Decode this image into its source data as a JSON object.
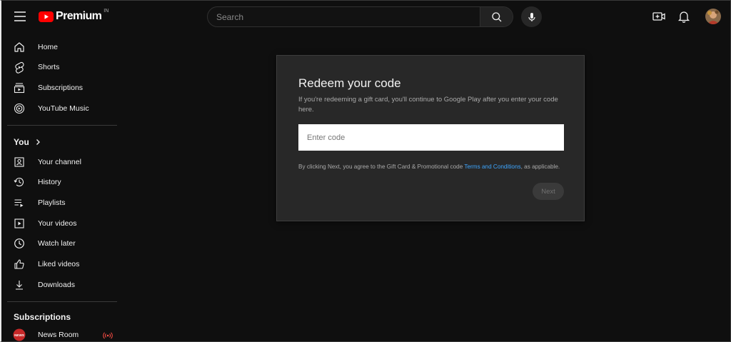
{
  "header": {
    "logo_text": "Premium",
    "country_code": "IN",
    "search_placeholder": "Search"
  },
  "sidebar": {
    "main_items": [
      {
        "label": "Home",
        "icon": "home-icon"
      },
      {
        "label": "Shorts",
        "icon": "shorts-icon"
      },
      {
        "label": "Subscriptions",
        "icon": "subscriptions-icon"
      },
      {
        "label": "YouTube Music",
        "icon": "youtube-music-icon"
      }
    ],
    "you_title": "You",
    "you_items": [
      {
        "label": "Your channel",
        "icon": "channel-icon"
      },
      {
        "label": "History",
        "icon": "history-icon"
      },
      {
        "label": "Playlists",
        "icon": "playlists-icon"
      },
      {
        "label": "Your videos",
        "icon": "your-videos-icon"
      },
      {
        "label": "Watch later",
        "icon": "watch-later-icon"
      },
      {
        "label": "Liked videos",
        "icon": "like-icon"
      },
      {
        "label": "Downloads",
        "icon": "download-icon"
      }
    ],
    "subscriptions_title": "Subscriptions",
    "subscriptions": [
      {
        "label": "News Room",
        "avatar_text": "NEWS",
        "live": true
      }
    ]
  },
  "dialog": {
    "title": "Redeem your code",
    "subtitle": "If you're redeeming a gift card, you'll continue to Google Play after you enter your code here.",
    "input_placeholder": "Enter code",
    "terms_prefix": "By clicking Next, you agree to the Gift Card & Promotional code ",
    "terms_link": "Terms and Conditions",
    "terms_suffix": ", as applicable.",
    "next_label": "Next"
  },
  "colors": {
    "background": "#0f0f0f",
    "dialog_bg": "#282828",
    "brand_red": "#ff0000",
    "link_blue": "#3ea6ff",
    "live_red": "#ff4e45"
  }
}
